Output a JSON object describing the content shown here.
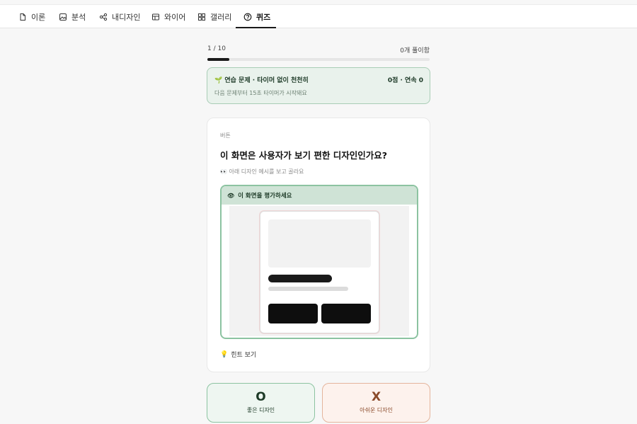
{
  "nav": {
    "tabs": [
      {
        "label": "이론",
        "icon": "document-icon"
      },
      {
        "label": "분석",
        "icon": "image-icon"
      },
      {
        "label": "내디자인",
        "icon": "share-icon"
      },
      {
        "label": "와이어",
        "icon": "layout-icon"
      },
      {
        "label": "갤러리",
        "icon": "grid-icon"
      },
      {
        "label": "퀴즈",
        "icon": "question-icon",
        "active": true
      }
    ]
  },
  "progress": {
    "counter": "1 / 10",
    "solved": "0개 풀이함",
    "fraction": 0.1
  },
  "practice": {
    "title": "🌱 연습 문제 · 타이머 없이 천천히",
    "score": "0점 · 연속 0",
    "subtitle": "다음 문제부터 15초 타이머가 시작돼요"
  },
  "question": {
    "category": "버튼",
    "text": "이 화면은 사용자가 보기 편한 디자인인가요?",
    "instruction": "👀 아래 디자인 예시를 보고 골라요",
    "preview_header": "이 화면을 평가하세요",
    "hint_label": "힌트 보기"
  },
  "answers": {
    "good": {
      "symbol": "O",
      "label": "좋은 디자인"
    },
    "bad": {
      "symbol": "X",
      "label": "아쉬운 디자인"
    }
  },
  "colors": {
    "accent_green": "#8cc3a1",
    "accent_orange": "#e4b49c",
    "dark": "#1a1a1a"
  }
}
